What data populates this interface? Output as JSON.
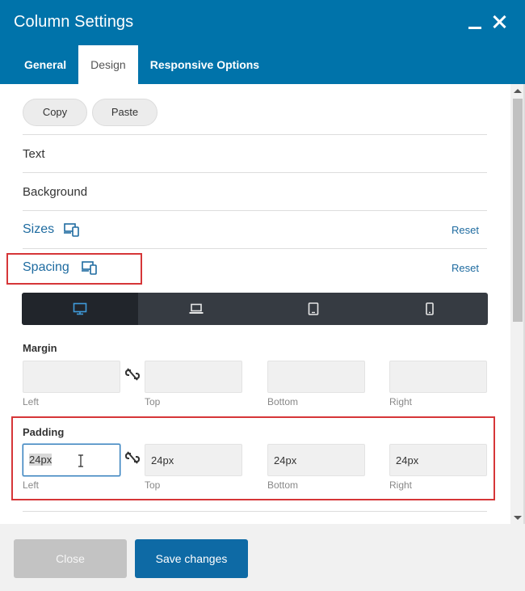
{
  "header": {
    "title": "Column Settings",
    "accent_color": "#0073aa",
    "minimize_icon": "minimize-icon",
    "close_icon": "close-icon"
  },
  "tabs": [
    {
      "label": "General",
      "active": false
    },
    {
      "label": "Design",
      "active": true
    },
    {
      "label": "Responsive Options",
      "active": false
    }
  ],
  "clipboard": {
    "copy_label": "Copy",
    "paste_label": "Paste"
  },
  "sections": [
    {
      "label": "Text",
      "expanded": false
    },
    {
      "label": "Background",
      "expanded": false
    },
    {
      "label": "Sizes",
      "expanded": false,
      "reset_label": "Reset",
      "icon": "responsive-devices-icon"
    },
    {
      "label": "Spacing",
      "expanded": true,
      "reset_label": "Reset",
      "icon": "responsive-devices-icon"
    }
  ],
  "device_switcher": {
    "selected": "desktop",
    "devices": [
      "desktop",
      "laptop",
      "tablet",
      "mobile"
    ]
  },
  "margin": {
    "label": "Margin",
    "fields": [
      {
        "sublabel": "Left",
        "value": ""
      },
      {
        "sublabel": "Top",
        "value": ""
      },
      {
        "sublabel": "Bottom",
        "value": ""
      },
      {
        "sublabel": "Right",
        "value": ""
      }
    ]
  },
  "padding": {
    "label": "Padding",
    "fields": [
      {
        "sublabel": "Left",
        "value": "24px",
        "focused": true
      },
      {
        "sublabel": "Top",
        "value": "24px"
      },
      {
        "sublabel": "Bottom",
        "value": "24px"
      },
      {
        "sublabel": "Right",
        "value": "24px"
      }
    ]
  },
  "footer": {
    "close_label": "Close",
    "save_label": "Save changes"
  },
  "highlight_color": "#d63638"
}
